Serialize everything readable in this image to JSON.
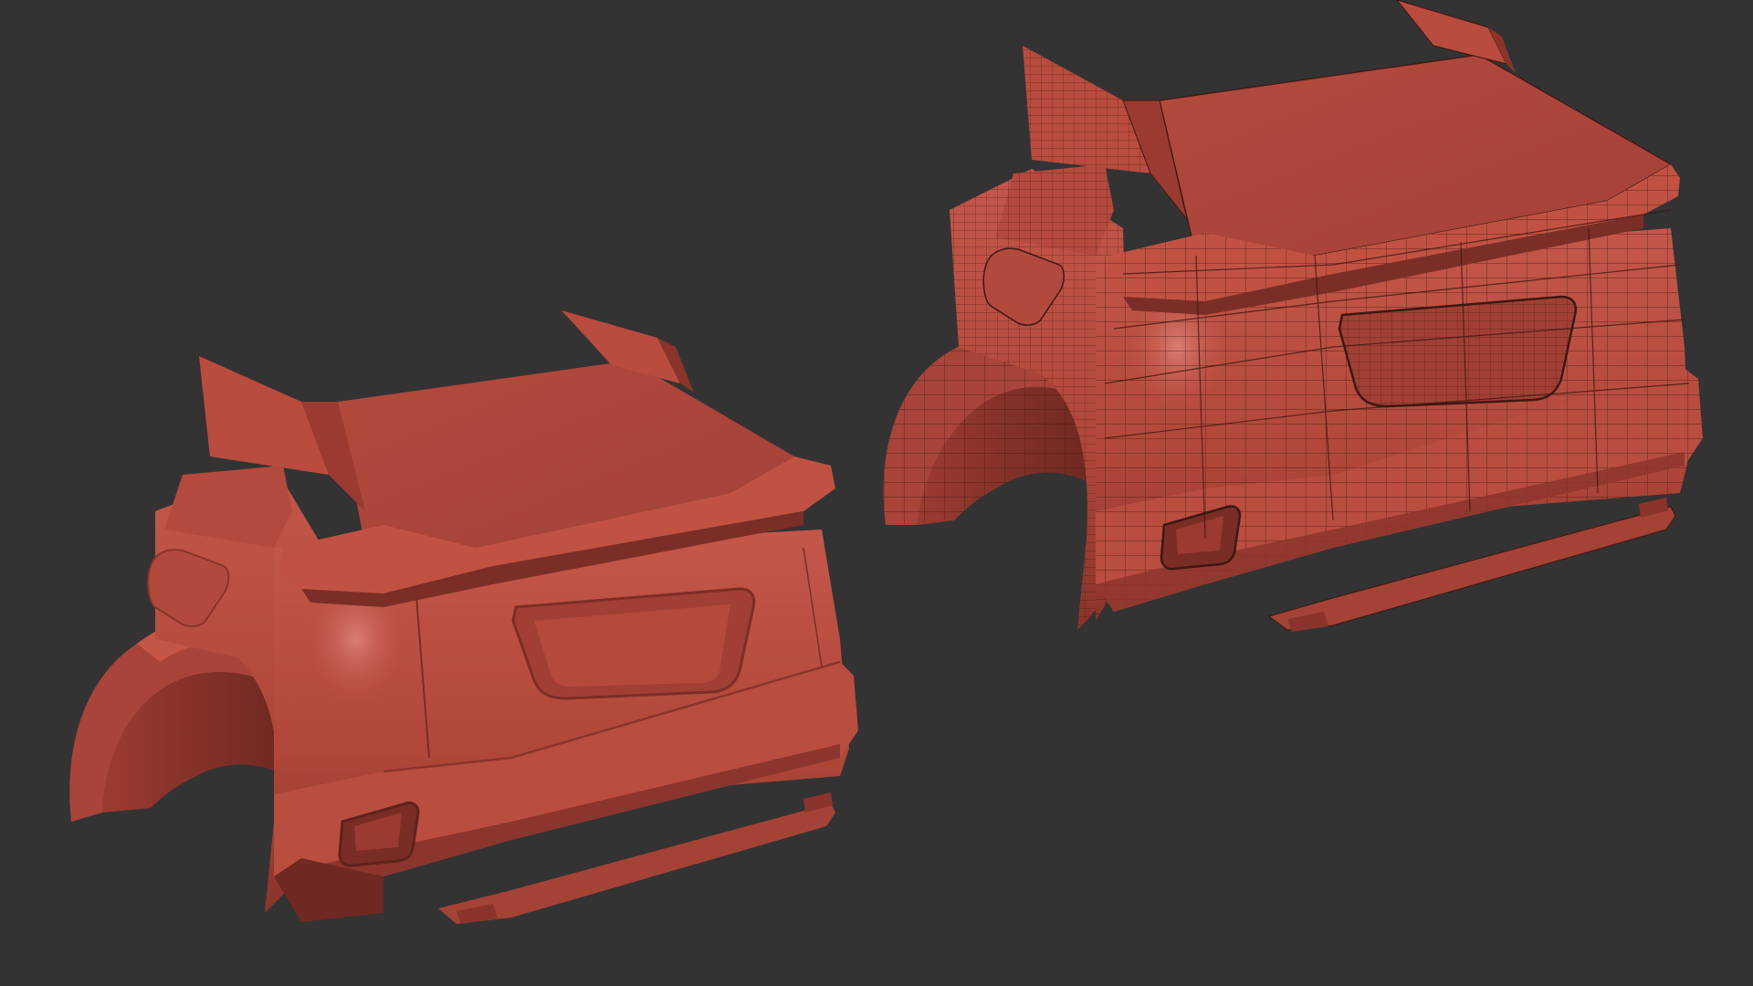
{
  "viewport": {
    "background_color": "#333333"
  },
  "materials": {
    "clay_base": "#b54a3e",
    "clay_light": "#c8594a",
    "clay_shadow": "#7e2f27",
    "clay_deep": "#5e221c",
    "wire_line": "#3c1812"
  },
  "models": [
    {
      "name": "shaded-model",
      "shading": "smooth"
    },
    {
      "name": "wireframe-model",
      "shading": "smooth-with-wireframe"
    }
  ]
}
